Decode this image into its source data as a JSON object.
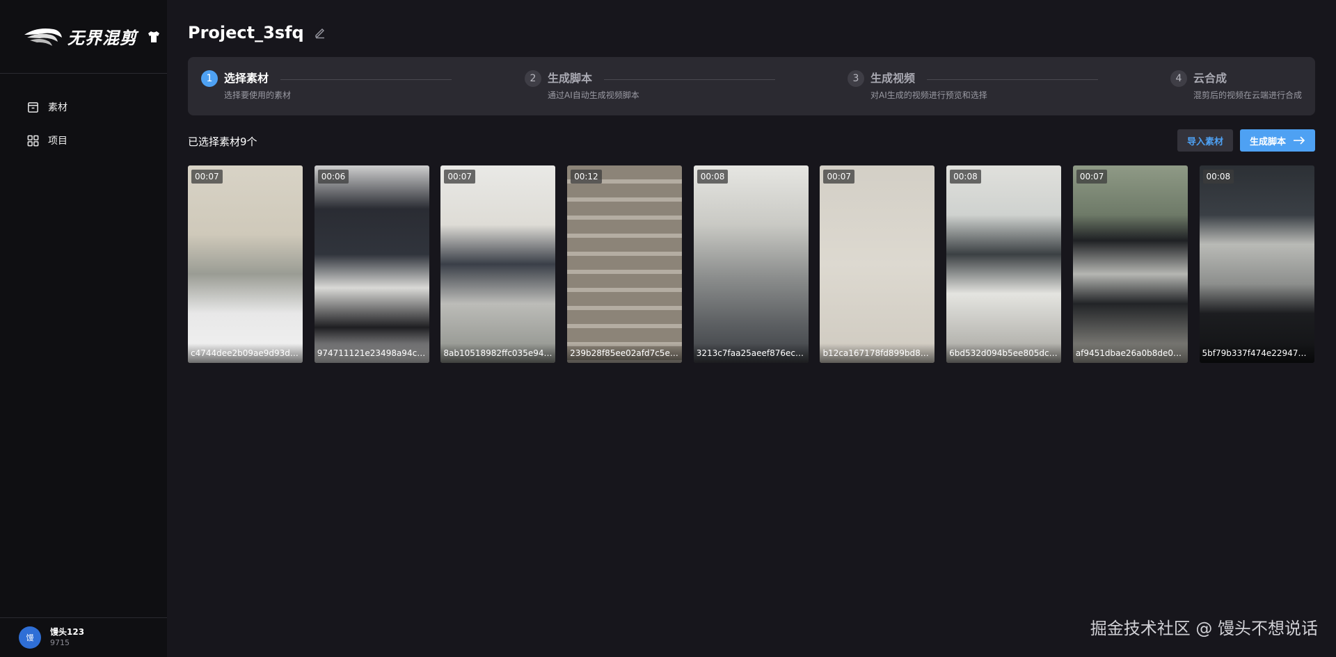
{
  "sidebar": {
    "logo_text": "无界混剪",
    "nav": [
      {
        "label": "素材",
        "icon": "box-icon"
      },
      {
        "label": "项目",
        "icon": "grid-icon"
      }
    ],
    "user": {
      "avatar_text": "馒",
      "name": "馒头123",
      "id": "9715"
    }
  },
  "header": {
    "title": "Project_3sfq"
  },
  "steps": [
    {
      "num": "1",
      "title": "选择素材",
      "desc": "选择要使用的素材",
      "active": true
    },
    {
      "num": "2",
      "title": "生成脚本",
      "desc": "通过AI自动生成视频脚本",
      "active": false
    },
    {
      "num": "3",
      "title": "生成视频",
      "desc": "对AI生成的视频进行预览和选择",
      "active": false
    },
    {
      "num": "4",
      "title": "云合成",
      "desc": "混剪后的视频在云端进行合成",
      "active": false
    }
  ],
  "toolbar": {
    "selected_count": "已选择素材9个",
    "import_label": "导入素材",
    "generate_label": "生成脚本"
  },
  "materials": [
    {
      "duration": "00:07",
      "name": "c4744dee2b09ae9d93d8ed..."
    },
    {
      "duration": "00:06",
      "name": "974711121e23498a94cc32..."
    },
    {
      "duration": "00:07",
      "name": "8ab10518982ffc035e94b59..."
    },
    {
      "duration": "00:12",
      "name": "239b28f85ee02afd7c5e382..."
    },
    {
      "duration": "00:08",
      "name": "3213c7faa25aeef876ec6f0e..."
    },
    {
      "duration": "00:07",
      "name": "b12ca167178fd899bd8c6c9..."
    },
    {
      "duration": "00:08",
      "name": "6bd532d094b5ee805dc004..."
    },
    {
      "duration": "00:07",
      "name": "af9451dbae26a0b8de05b1..."
    },
    {
      "duration": "00:08",
      "name": "5bf79b337f474e22947835..."
    }
  ],
  "watermark": "掘金技术社区 @ 馒头不想说话"
}
